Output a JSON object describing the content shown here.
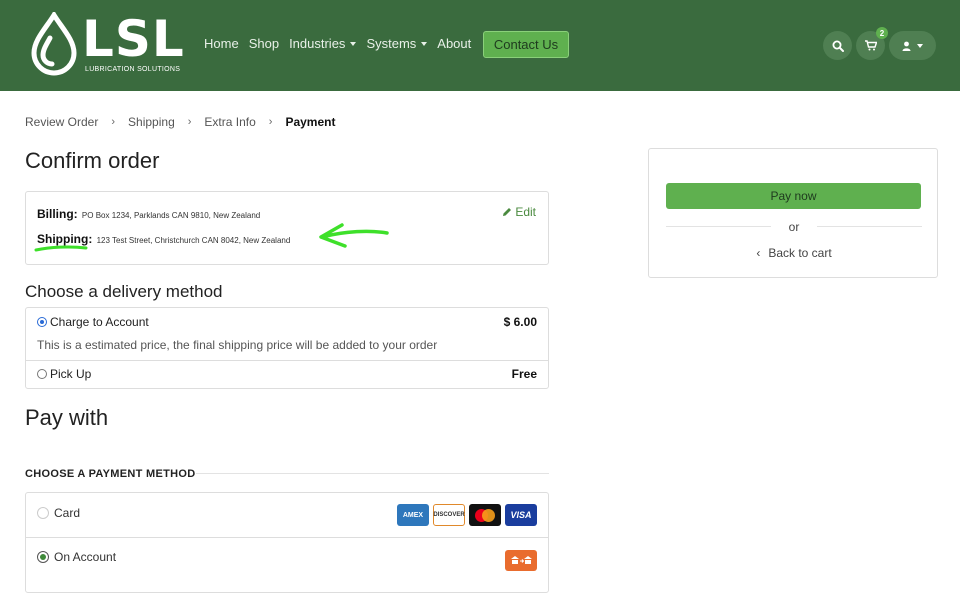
{
  "header": {
    "logo_text": "LSL",
    "logo_subtitle": "LUBRICATION SOLUTIONS",
    "nav": [
      {
        "label": "Home"
      },
      {
        "label": "Shop"
      },
      {
        "label": "Industries"
      },
      {
        "label": "Systems"
      },
      {
        "label": "About"
      }
    ],
    "contact_label": "Contact Us",
    "cart_count": "2",
    "icons": {
      "search": "search-icon",
      "cart": "cart-icon",
      "user": "user-icon"
    },
    "colors": {
      "bg": "#3a6b3e",
      "accent": "#5fb04f"
    }
  },
  "breadcrumb": {
    "items": [
      "Review Order",
      "Shipping",
      "Extra Info",
      "Payment"
    ]
  },
  "main": {
    "title": "Confirm order",
    "billing_label": "Billing:",
    "billing_value": "PO Box 1234, Parklands CAN 9810, New Zealand",
    "shipping_label": "Shipping:",
    "shipping_value": "123 Test Street, Christchurch CAN 8042, New Zealand",
    "edit_label": "Edit"
  },
  "delivery": {
    "title": "Choose a delivery method",
    "options": [
      {
        "label": "Charge to Account",
        "price": "$ 6.00",
        "note": "This is a estimated price, the final shipping price will be added to your order",
        "selected": true
      },
      {
        "label": "Pick Up",
        "price": "Free",
        "selected": false
      }
    ]
  },
  "payment": {
    "title": "Pay with",
    "heading": "CHOOSE A PAYMENT METHOD",
    "methods": [
      {
        "label": "Card",
        "selected": false
      },
      {
        "label": "On Account",
        "selected": true
      }
    ],
    "card_brands": [
      "AMEX",
      "DISCOVER",
      "",
      "VISA"
    ]
  },
  "side": {
    "pay_now": "Pay now",
    "or": "or",
    "back_to_cart": "Back to cart"
  }
}
